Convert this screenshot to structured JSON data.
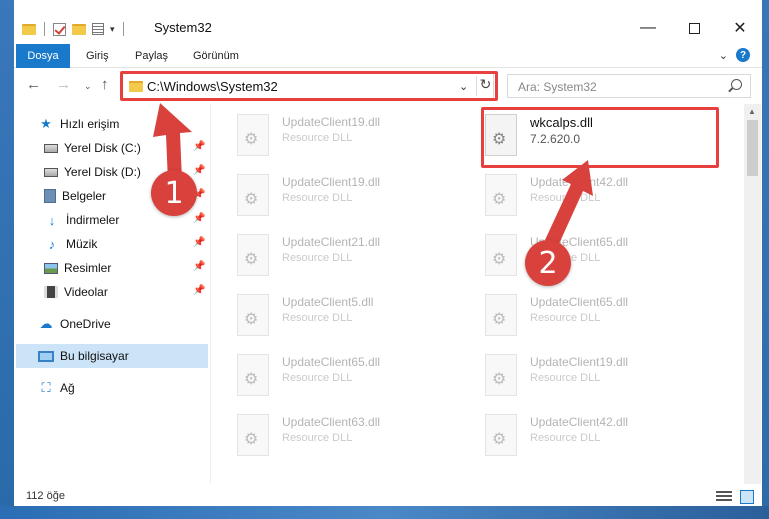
{
  "window": {
    "title": "System32",
    "controls": {
      "minimize": "—",
      "maximize": "",
      "close": "✕"
    }
  },
  "ribbon": {
    "tabs": [
      "Dosya",
      "Giriş",
      "Paylaş",
      "Görünüm"
    ],
    "expand": "⌄",
    "help": "?"
  },
  "nav": {
    "back": "←",
    "forward": "→",
    "recent": "⌄",
    "up": "↑",
    "address": "C:\\Windows\\System32",
    "address_drop": "⌄",
    "refresh": "↻",
    "search_placeholder": "Ara: System32"
  },
  "sidebar": {
    "items": [
      {
        "label": "Hızlı erişim",
        "icon": "star-icon",
        "glyph": "★",
        "pinned": false
      },
      {
        "label": "Yerel Disk (C:)",
        "icon": "drive-icon",
        "glyph": "",
        "pinned": true
      },
      {
        "label": "Yerel Disk (D:)",
        "icon": "drive-icon",
        "glyph": "",
        "pinned": true
      },
      {
        "label": "Belgeler",
        "icon": "documents-icon",
        "glyph": "",
        "pinned": true
      },
      {
        "label": "İndirmeler",
        "icon": "download-icon",
        "glyph": "↓",
        "pinned": true
      },
      {
        "label": "Müzik",
        "icon": "music-icon",
        "glyph": "♪",
        "pinned": true
      },
      {
        "label": "Resimler",
        "icon": "pictures-icon",
        "glyph": "",
        "pinned": true
      },
      {
        "label": "Videolar",
        "icon": "videos-icon",
        "glyph": "",
        "pinned": true
      },
      {
        "label": "OneDrive",
        "icon": "cloud-icon",
        "glyph": "☁",
        "pinned": false
      },
      {
        "label": "Bu bilgisayar",
        "icon": "computer-icon",
        "glyph": "",
        "pinned": false,
        "selected": true
      },
      {
        "label": "Ağ",
        "icon": "network-icon",
        "glyph": "⛶",
        "pinned": false
      }
    ],
    "pin_glyph": "📌"
  },
  "files": {
    "left": [
      {
        "name": "UpdateClient19.dll",
        "desc": "Resource DLL"
      },
      {
        "name": "UpdateClient19.dll",
        "desc": "Resource DLL"
      },
      {
        "name": "UpdateClient21.dll",
        "desc": "Resource DLL"
      },
      {
        "name": "UpdateClient5.dll",
        "desc": "Resource DLL"
      },
      {
        "name": "UpdateClient65.dll",
        "desc": "Resource DLL"
      },
      {
        "name": "UpdateClient63.dll",
        "desc": "Resource DLL"
      }
    ],
    "right": [
      {
        "name": "wkcalps.dll",
        "desc": "7.2.620.0",
        "highlighted": true
      },
      {
        "name": "UpdateClient42.dll",
        "desc": "Resource DLL"
      },
      {
        "name": "UpdateClient65.dll",
        "desc": "Resource DLL"
      },
      {
        "name": "UpdateClient65.dll",
        "desc": "Resource DLL"
      },
      {
        "name": "UpdateClient19.dll",
        "desc": "Resource DLL"
      },
      {
        "name": "UpdateClient42.dll",
        "desc": "Resource DLL"
      }
    ]
  },
  "status": {
    "count": "112 öğe"
  },
  "annotations": {
    "badge1": "1",
    "badge2": "2",
    "color": "#e8403e"
  }
}
